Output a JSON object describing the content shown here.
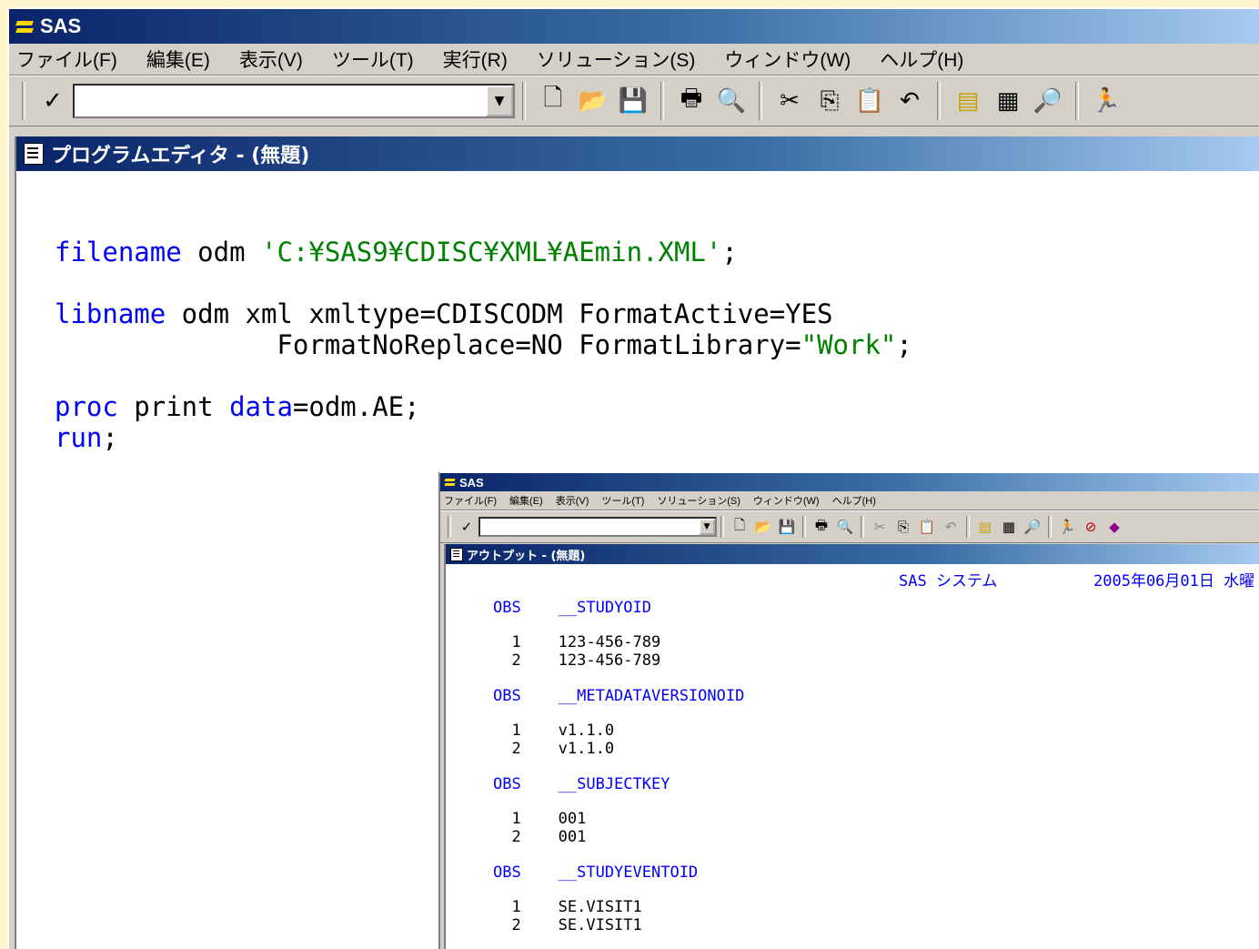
{
  "main_window": {
    "title": "SAS",
    "menu": [
      "ファイル(F)",
      "編集(E)",
      "表示(V)",
      "ツール(T)",
      "実行(R)",
      "ソリューション(S)",
      "ウィンドウ(W)",
      "ヘルプ(H)"
    ],
    "command_value": "",
    "editor_title": "プログラムエディタ - (無題)",
    "code": {
      "line1_kw": "filename",
      "line1_rest": " odm ",
      "line1_str": "'C:¥SAS9¥CDISC¥XML¥AEmin.XML'",
      "line1_end": ";",
      "line2_kw": "libname",
      "line2_rest": " odm xml xmltype=CDISCODM FormatActive=YES",
      "line3_rest": "              FormatNoReplace=NO FormatLibrary=",
      "line3_str": "\"Work\"",
      "line3_end": ";",
      "line4_kw1": "proc",
      "line4_mid": " print ",
      "line4_kw2": "data",
      "line4_end": "=odm.AE;",
      "line5_kw": "run",
      "line5_end": ";"
    }
  },
  "output_window": {
    "title": "SAS",
    "menu": [
      "ファイル(F)",
      "編集(E)",
      "表示(V)",
      "ツール(T)",
      "ソリューション(S)",
      "ウィンドウ(W)",
      "ヘルプ(H)"
    ],
    "editor_title": "アウトプット - (無題)",
    "system_label": "SAS システム",
    "date_label": "2005年06月01日 水曜",
    "blocks": [
      {
        "header": "OBS    __STUDYOID",
        "rows": [
          "  1    123-456-789",
          "  2    123-456-789"
        ]
      },
      {
        "header": "OBS    __METADATAVERSIONOID",
        "rows": [
          "  1    v1.1.0",
          "  2    v1.1.0"
        ]
      },
      {
        "header": "OBS    __SUBJECTKEY",
        "rows": [
          "  1    001",
          "  2    001"
        ]
      },
      {
        "header": "OBS    __STUDYEVENTOID",
        "rows": [
          "  1    SE.VISIT1",
          "  2    SE.VISIT1"
        ]
      }
    ]
  },
  "icons": [
    "check-icon",
    "new-file-icon",
    "open-folder-icon",
    "save-icon",
    "print-icon",
    "print-preview-icon",
    "cut-icon",
    "copy-icon",
    "paste-icon",
    "undo-icon",
    "explorer-icon",
    "log-icon",
    "find-icon",
    "run-icon"
  ],
  "colors": {
    "titlebar_start": "#0A246A",
    "titlebar_end": "#A6CAF0",
    "keyword": "#0000FF",
    "string": "#008000",
    "chrome": "#D4D0C8",
    "background": "#FFF4CC"
  }
}
